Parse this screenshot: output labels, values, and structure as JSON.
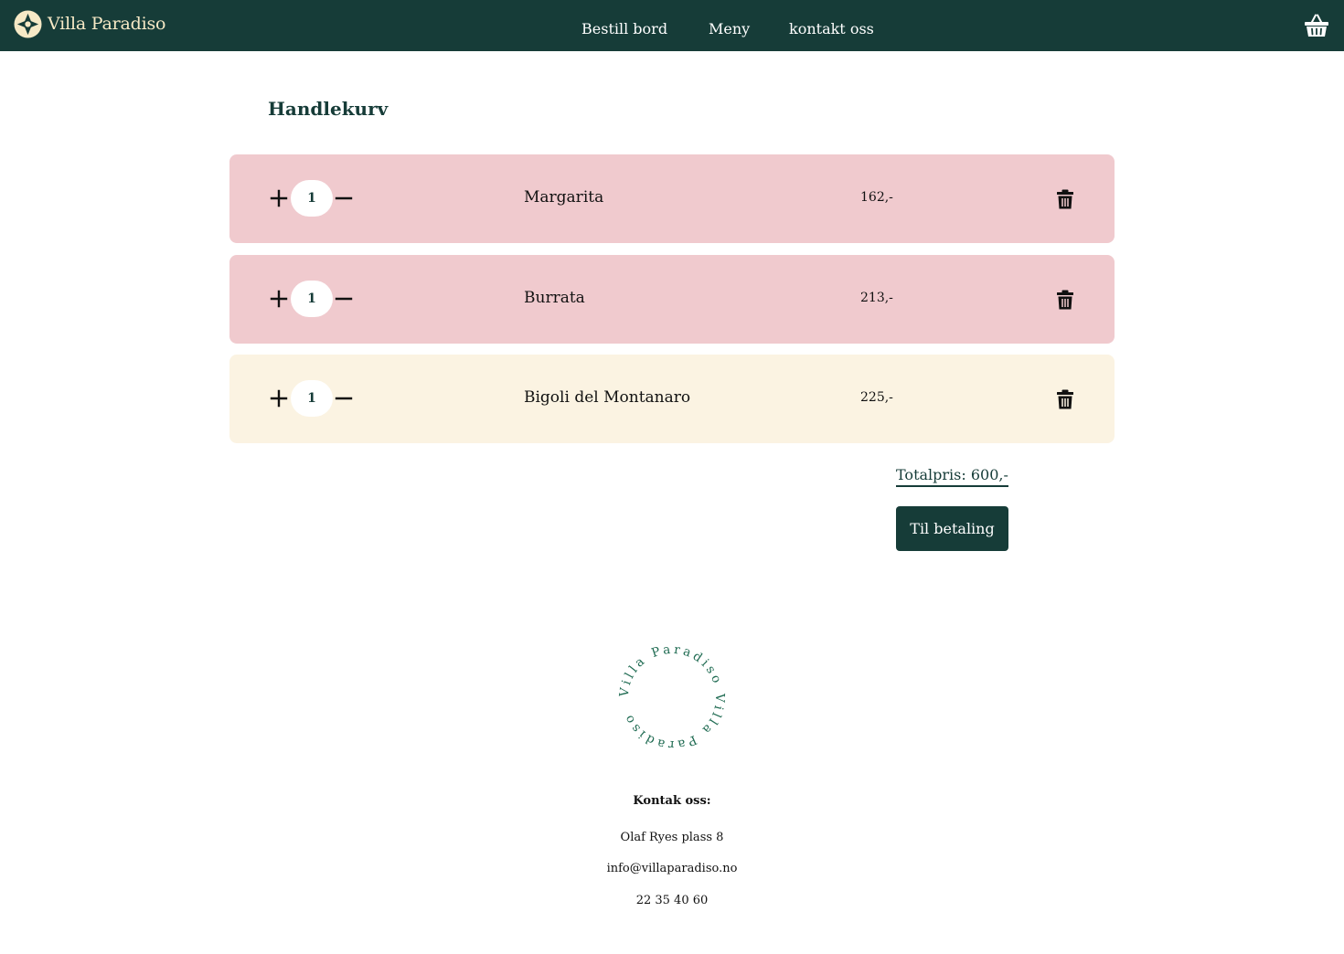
{
  "header": {
    "brand_name": "Villa Paradiso",
    "brand_logo_icon": "compass-rose-icon",
    "nav": [
      {
        "label": "Bestill bord"
      },
      {
        "label": "Meny"
      },
      {
        "label": "kontakt oss"
      }
    ],
    "cart_icon": "shopping-basket-icon"
  },
  "cart": {
    "title": "Handlekurv",
    "items": [
      {
        "quantity": "1",
        "name": "Margarita",
        "price": "162,-",
        "row_color": "#f0cace"
      },
      {
        "quantity": "1",
        "name": "Burrata",
        "price": "213,-",
        "row_color": "#f0cace"
      },
      {
        "quantity": "1",
        "name": "Bigoli del Montanaro",
        "price": "225,-",
        "row_color": "#fbf3e2"
      }
    ],
    "plus_icon": "plus-icon",
    "minus_icon": "minus-icon",
    "delete_icon": "trash-icon",
    "total_label": "Totalpris: 600,-",
    "checkout_label": "Til betaling"
  },
  "footer": {
    "seal_text": "Villa Paradiso Villa Paradiso",
    "heading": "Kontak oss:",
    "address": "Olaf Ryes plass 8",
    "email": "info@villaparadiso.no",
    "phone": "22 35 40 60"
  },
  "colors": {
    "primary": "#163c38",
    "brand_text": "#f6e9c6",
    "row_pink": "#f0cace",
    "row_cream": "#fbf3e2",
    "seal_text": "#1f6b52"
  }
}
